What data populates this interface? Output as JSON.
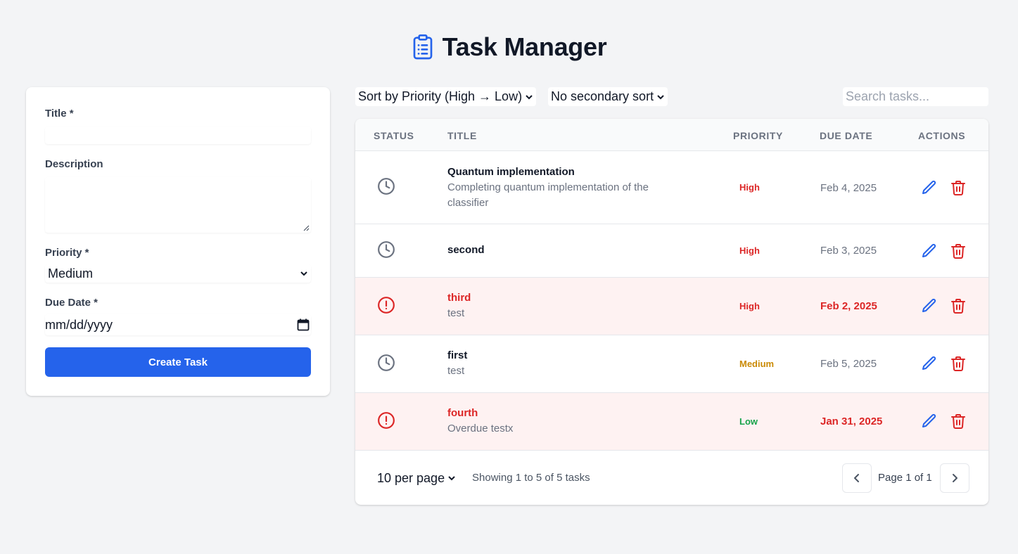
{
  "app": {
    "title": "Task Manager",
    "icon": "clipboard-list-icon",
    "accent": "#2563eb"
  },
  "form": {
    "title_label": "Title *",
    "title_value": "",
    "description_label": "Description",
    "description_value": "",
    "priority_label": "Priority *",
    "priority_value": "Medium",
    "due_label": "Due Date *",
    "due_value": "mm/dd/yyyy",
    "submit_label": "Create Task"
  },
  "toolbar": {
    "sort_primary": "Sort by Priority (High → Low)",
    "sort_secondary": "No secondary sort",
    "search_placeholder": "Search tasks..."
  },
  "table": {
    "headers": [
      "STATUS",
      "TITLE",
      "PRIORITY",
      "DUE DATE",
      "ACTIONS"
    ],
    "rows": [
      {
        "status": "clock-icon",
        "title": "Quantum implementation",
        "description": "Completing quantum implementation of the classifier",
        "priority": "High",
        "due": "Feb 4, 2025",
        "overdue": false
      },
      {
        "status": "clock-icon",
        "title": "second",
        "description": "",
        "priority": "High",
        "due": "Feb 3, 2025",
        "overdue": false
      },
      {
        "status": "alert-circle-icon",
        "title": "third",
        "description": "test",
        "priority": "High",
        "due": "Feb 2, 2025",
        "overdue": true
      },
      {
        "status": "clock-icon",
        "title": "first",
        "description": "test",
        "priority": "Medium",
        "due": "Feb 5, 2025",
        "overdue": false
      },
      {
        "status": "alert-circle-icon",
        "title": "fourth",
        "description": "Overdue testx",
        "priority": "Low",
        "due": "Jan 31, 2025",
        "overdue": true
      }
    ]
  },
  "pagination": {
    "per_page": "10 per page",
    "showing": "Showing 1 to 5 of 5 tasks",
    "page_text": "Page 1 of 1"
  },
  "colors": {
    "high": "#dc2626",
    "medium": "#ca8a04",
    "low": "#16a34a",
    "overdue_bg": "#fef2f2"
  }
}
